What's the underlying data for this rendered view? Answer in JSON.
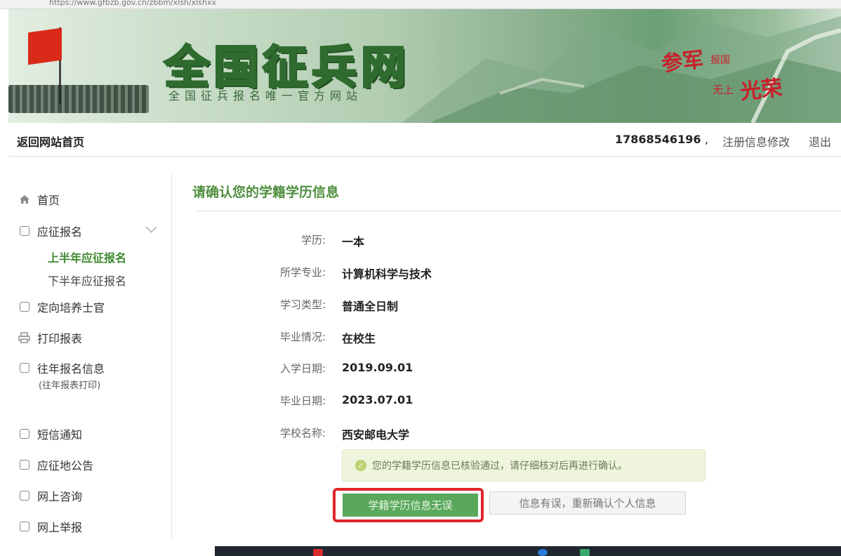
{
  "browser": {
    "url": "https://www.gfbzb.gov.cn/zbbm/xlsh/xlshxx"
  },
  "banner": {
    "title": "全国征兵网",
    "subtitle": "全国征兵报名唯一官方网站",
    "slogan_a": "参军",
    "slogan_b": "报国",
    "slogan_c": "无上",
    "slogan_d": "光荣"
  },
  "navbar": {
    "home": "返回网站首页",
    "phone": "17868546196",
    "edit": "注册信息修改",
    "logout": "退出"
  },
  "sidebar": {
    "items": [
      {
        "label": "首页",
        "icon": "home-icon"
      },
      {
        "label": "应征报名",
        "icon": "signup-icon"
      },
      {
        "label": "定向培养士官",
        "icon": "sergeant-icon"
      },
      {
        "label": "打印报表",
        "icon": "print-icon"
      },
      {
        "label": "往年报名信息",
        "icon": "history-icon"
      },
      {
        "label": "短信通知",
        "icon": "sms-icon"
      },
      {
        "label": "应征地公告",
        "icon": "notice-icon"
      },
      {
        "label": "网上咨询",
        "icon": "consult-icon"
      },
      {
        "label": "网上举报",
        "icon": "report-icon"
      }
    ],
    "sub_items": [
      "上半年应征报名",
      "下半年应征报名"
    ],
    "history_note": "(往年报表打印)"
  },
  "content": {
    "title": "请确认您的学籍学历信息",
    "rows": [
      {
        "label": "学历:",
        "value": "一本"
      },
      {
        "label": "所学专业:",
        "value": "计算机科学与技术"
      },
      {
        "label": "学习类型:",
        "value": "普通全日制"
      },
      {
        "label": "毕业情况:",
        "value": "在校生"
      },
      {
        "label": "入学日期:",
        "value": "2019.09.01"
      },
      {
        "label": "毕业日期:",
        "value": "2023.07.01"
      },
      {
        "label": "学校名称:",
        "value": "西安邮电大学"
      }
    ],
    "notice": "您的学籍学历信息已核验通过，请仔细核对后再进行确认。",
    "confirm_button": "学籍学历信息无误",
    "wrong_button": "信息有误，重新确认个人信息"
  }
}
